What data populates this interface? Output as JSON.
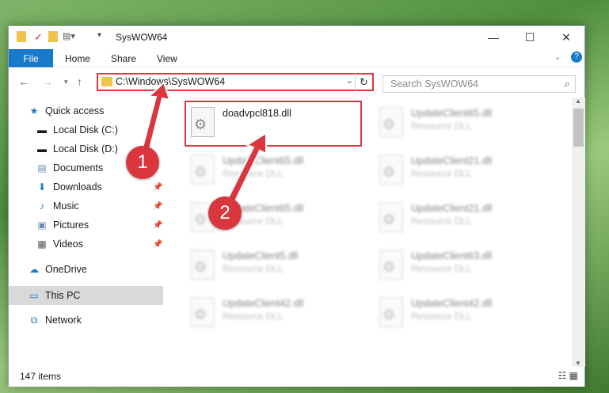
{
  "window": {
    "title": "SysWOW64"
  },
  "ribbon": {
    "file_label": "File",
    "tabs": [
      "Home",
      "Share",
      "View"
    ]
  },
  "address": {
    "path": "C:\\Windows\\SysWOW64",
    "search_placeholder": "Search SysWOW64"
  },
  "sidebar": {
    "items": [
      {
        "label": "Quick access",
        "icon": "star-icon"
      },
      {
        "label": "Local Disk (C:)",
        "icon": "drive-icon"
      },
      {
        "label": "Local Disk (D:)",
        "icon": "drive-icon"
      },
      {
        "label": "Documents",
        "icon": "documents-icon"
      },
      {
        "label": "Downloads",
        "icon": "downloads-icon"
      },
      {
        "label": "Music",
        "icon": "music-icon"
      },
      {
        "label": "Pictures",
        "icon": "pictures-icon"
      },
      {
        "label": "Videos",
        "icon": "videos-icon"
      },
      {
        "label": "OneDrive",
        "icon": "cloud-icon"
      },
      {
        "label": "This PC",
        "icon": "computer-icon"
      },
      {
        "label": "Network",
        "icon": "network-icon"
      }
    ],
    "selected": "This PC"
  },
  "files": [
    {
      "name": "doadvpcl818.dll",
      "type": ""
    },
    {
      "name": "UpdateClient65.dll",
      "type": "Resource DLL"
    },
    {
      "name": "UpdateClient65.dll",
      "type": "Resource DLL"
    },
    {
      "name": "UpdateClient21.dll",
      "type": "Resource DLL"
    },
    {
      "name": "UpdateClient65.dll",
      "type": "Resource DLL"
    },
    {
      "name": "UpdateClient21.dll",
      "type": "Resource DLL"
    },
    {
      "name": "UpdateClient5.dll",
      "type": "Resource DLL"
    },
    {
      "name": "UpdateClient63.dll",
      "type": "Resource DLL"
    },
    {
      "name": "UpdateClient42.dll",
      "type": "Resource DLL"
    },
    {
      "name": "UpdateClient42.dll",
      "type": "Resource DLL"
    }
  ],
  "status": {
    "item_count": "147 items"
  },
  "markers": {
    "first": "1",
    "second": "2"
  },
  "colors": {
    "accent": "#1979ca",
    "highlight": "#d9363e"
  }
}
